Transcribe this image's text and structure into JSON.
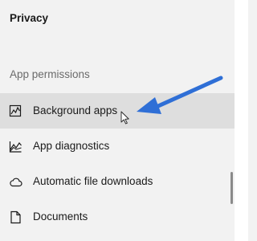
{
  "header": {
    "title": "Privacy"
  },
  "section": {
    "label": "App permissions"
  },
  "items": [
    {
      "label": "Background apps",
      "icon": "background-apps-icon",
      "selected": true
    },
    {
      "label": "App diagnostics",
      "icon": "app-diagnostics-icon",
      "selected": false
    },
    {
      "label": "Automatic file downloads",
      "icon": "cloud-icon",
      "selected": false
    },
    {
      "label": "Documents",
      "icon": "document-icon",
      "selected": false
    }
  ],
  "colors": {
    "background": "#f2f2f2",
    "selected": "#dedede",
    "annotation_arrow": "#2f6fd6",
    "section_text": "#6b6b6b"
  }
}
